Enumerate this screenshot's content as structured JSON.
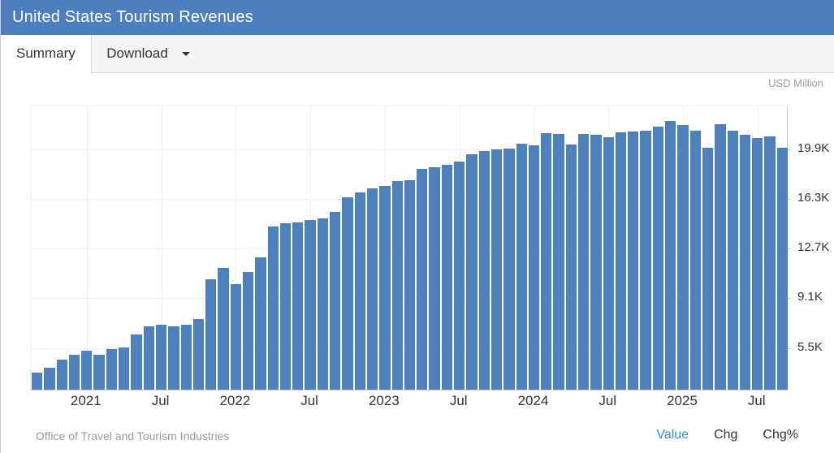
{
  "header": {
    "title": "United States Tourism Revenues"
  },
  "tabs": [
    {
      "label": "Summary",
      "active": true
    },
    {
      "label": "Download",
      "active": false,
      "has_caret": true
    }
  ],
  "chart": {
    "unit_label": "USD Million",
    "source": "Office of Travel and Tourism Industries",
    "footer_links": [
      {
        "label": "Value",
        "active": true
      },
      {
        "label": "Chg",
        "active": false
      },
      {
        "label": "Chg%",
        "active": false
      }
    ],
    "colors": {
      "header_bg": "#4d7fbe",
      "bar": "#4e80bc",
      "active_link": "#2a90e9",
      "axis_text": "#333333",
      "muted_text": "#9b9b9b"
    }
  },
  "chart_data": {
    "type": "bar",
    "title": "United States Tourism Revenues",
    "ylabel": "USD Million",
    "xlabel": "",
    "grid": true,
    "legend": false,
    "x": [
      "2020-09",
      "2020-10",
      "2020-11",
      "2020-12",
      "2021-01",
      "2021-02",
      "2021-03",
      "2021-04",
      "2021-05",
      "2021-06",
      "2021-07",
      "2021-08",
      "2021-09",
      "2021-10",
      "2021-11",
      "2021-12",
      "2022-01",
      "2022-02",
      "2022-03",
      "2022-04",
      "2022-05",
      "2022-06",
      "2022-07",
      "2022-08",
      "2022-09",
      "2022-10",
      "2022-11",
      "2022-12",
      "2023-01",
      "2023-02",
      "2023-03",
      "2023-04",
      "2023-05",
      "2023-06",
      "2023-07",
      "2023-08",
      "2023-09",
      "2023-10",
      "2023-11",
      "2023-12",
      "2024-01",
      "2024-02",
      "2024-03",
      "2024-04",
      "2024-05",
      "2024-06",
      "2024-07",
      "2024-08",
      "2024-09",
      "2024-10",
      "2024-11",
      "2024-12",
      "2025-01",
      "2025-02",
      "2025-03",
      "2025-04",
      "2025-05",
      "2025-06",
      "2025-07",
      "2025-08",
      "2025-09"
    ],
    "values": [
      3600,
      3950,
      4550,
      4900,
      5150,
      4900,
      5300,
      5400,
      6350,
      6950,
      7050,
      6950,
      7050,
      7500,
      10350,
      11150,
      10000,
      10900,
      11950,
      14200,
      14400,
      14450,
      14650,
      14750,
      15250,
      16300,
      16650,
      16950,
      17100,
      17450,
      17550,
      18350,
      18500,
      18650,
      18900,
      19400,
      19650,
      19750,
      19800,
      20150,
      20050,
      20950,
      20900,
      20100,
      20900,
      20800,
      20650,
      21000,
      21050,
      21100,
      21400,
      21850,
      21550,
      21100,
      19900,
      21600,
      21100,
      20800,
      20600,
      20700,
      19900
    ],
    "y_axis": {
      "min": 2350,
      "max": 23000,
      "gridlines": [
        {
          "value": 19900,
          "label": "19.9K"
        },
        {
          "value": 16300,
          "label": "16.3K"
        },
        {
          "value": 12700,
          "label": "12.7K"
        },
        {
          "value": 9100,
          "label": "9.1K"
        },
        {
          "value": 5500,
          "label": "5.5K"
        }
      ]
    },
    "x_ticks": [
      {
        "index": 4,
        "label": "2021"
      },
      {
        "index": 10,
        "label": "Jul"
      },
      {
        "index": 16,
        "label": "2022"
      },
      {
        "index": 22,
        "label": "Jul"
      },
      {
        "index": 28,
        "label": "2023"
      },
      {
        "index": 34,
        "label": "Jul"
      },
      {
        "index": 40,
        "label": "2024"
      },
      {
        "index": 46,
        "label": "Jul"
      },
      {
        "index": 52,
        "label": "2025"
      },
      {
        "index": 58,
        "label": "Jul"
      }
    ]
  }
}
